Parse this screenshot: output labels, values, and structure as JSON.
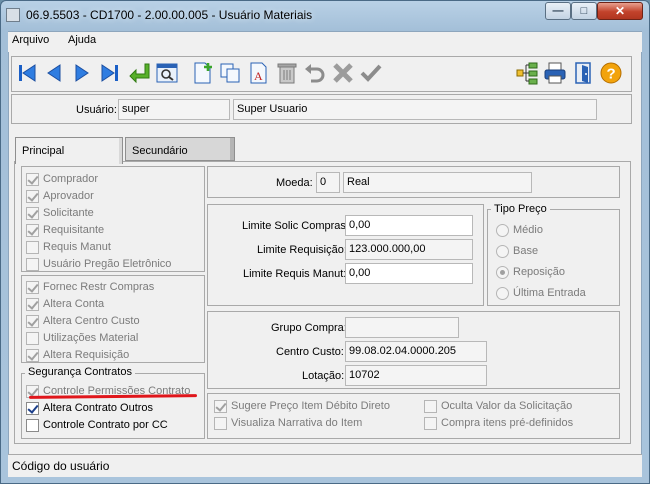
{
  "window": {
    "title": "06.9.5503 - CD1700 - 2.00.00.005 - Usuário Materiais"
  },
  "menu": [
    {
      "label": "Arquivo"
    },
    {
      "label": "Ajuda"
    }
  ],
  "toolbar": {
    "icons": [
      "first-icon",
      "prev-icon",
      "next-icon",
      "last-icon",
      "goto-icon",
      "search-icon",
      "new-icon",
      "copy-icon",
      "edit-icon",
      "delete-icon",
      "undo-icon",
      "cancel-icon",
      "confirm-icon",
      "tree-icon",
      "print-icon",
      "exit-icon",
      "help-icon"
    ]
  },
  "user": {
    "label": "Usuário:",
    "code": "super",
    "name": "Super Usuario"
  },
  "tabs": [
    {
      "label": "Principal"
    },
    {
      "label": "Secundário"
    }
  ],
  "roles": [
    {
      "label": "Comprador",
      "checked": true
    },
    {
      "label": "Aprovador",
      "checked": true
    },
    {
      "label": "Solicitante",
      "checked": true
    },
    {
      "label": "Requisitante",
      "checked": true
    },
    {
      "label": "Requis Manut",
      "checked": false
    },
    {
      "label": "Usuário Pregão Eletrônico",
      "checked": false
    }
  ],
  "permissions": [
    {
      "label": "Fornec Restr Compras",
      "checked": true
    },
    {
      "label": "Altera Conta",
      "checked": true
    },
    {
      "label": "Altera Centro Custo",
      "checked": true
    },
    {
      "label": "Utilizações Material",
      "checked": false
    },
    {
      "label": "Altera Requisição",
      "checked": true
    }
  ],
  "contract_security": {
    "title": "Segurança Contratos",
    "items": [
      {
        "label": "Controle Permissões Contrato",
        "checked": true,
        "enabled": false
      },
      {
        "label": "Altera Contrato Outros",
        "checked": true,
        "enabled": true
      },
      {
        "label": "Controle Contrato por CC",
        "checked": false,
        "enabled": true
      }
    ]
  },
  "currency": {
    "label": "Moeda:",
    "code": "0",
    "name": "Real"
  },
  "limits": [
    {
      "label": "Limite Solic Compras:",
      "value": "0,00"
    },
    {
      "label": "Limite Requisição:",
      "value": "123.000.000,00"
    },
    {
      "label": "Limite Requis Manut:",
      "value": "0,00"
    }
  ],
  "price_type": {
    "title": "Tipo Preço",
    "options": [
      {
        "label": "Médio",
        "selected": false
      },
      {
        "label": "Base",
        "selected": false
      },
      {
        "label": "Reposição",
        "selected": true
      },
      {
        "label": "Última Entrada",
        "selected": false
      }
    ]
  },
  "purchase_group": {
    "label": "Grupo Compra:",
    "value": ""
  },
  "cost_center": {
    "label": "Centro Custo:",
    "value": "99.08.02.04.0000.205"
  },
  "allocation": {
    "label": "Lotação:",
    "value": "10702"
  },
  "options": [
    {
      "label": "Sugere Preço Item Débito Direto",
      "checked": true
    },
    {
      "label": "Oculta Valor da Solicitação",
      "checked": false
    },
    {
      "label": "Visualiza Narrativa do Item",
      "checked": false
    },
    {
      "label": "Compra itens pré-definidos",
      "checked": false
    }
  ],
  "status": {
    "text": "Código do usuário"
  }
}
